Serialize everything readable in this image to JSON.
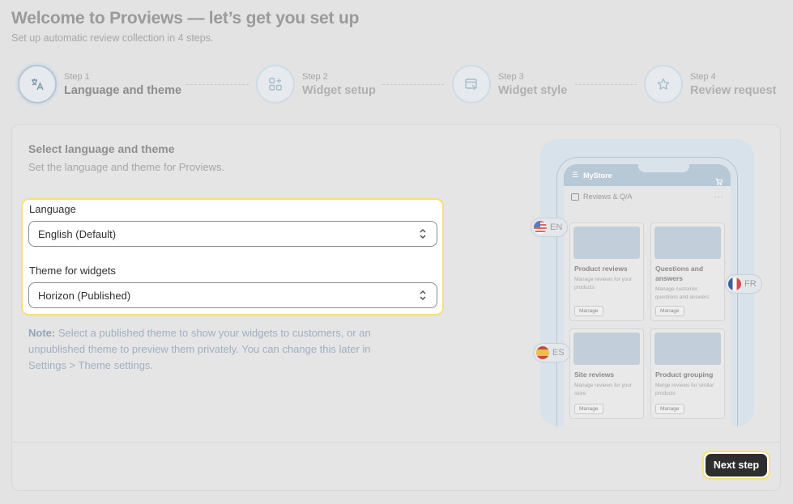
{
  "header": {
    "title": "Welcome to Proviews — let’s get you set up",
    "subtitle": "Set up automatic review collection in 4 steps."
  },
  "steps": [
    {
      "number": "Step 1",
      "label": "Language and theme",
      "icon": "translate-icon",
      "active": true
    },
    {
      "number": "Step 2",
      "label": "Widget setup",
      "icon": "widget-add-icon",
      "active": false
    },
    {
      "number": "Step 3",
      "label": "Widget style",
      "icon": "paint-window-icon",
      "active": false
    },
    {
      "number": "Step 4",
      "label": "Review request",
      "icon": "star-icon",
      "active": false
    }
  ],
  "section": {
    "title": "Select language and theme",
    "description": "Set the language and theme for Proviews."
  },
  "form": {
    "language_label": "Language",
    "language_value": "English (Default)",
    "theme_label": "Theme for widgets",
    "theme_value": "Horizon (Published)"
  },
  "note": {
    "prefix": "Note:",
    "line1": " Select a published theme to show your widgets to customers, or an",
    "line2": "unpublished theme to preview them privately. You can change this later in",
    "line3": "Settings > Theme settings."
  },
  "illustration": {
    "store_name": "MyStore",
    "app_title": "Reviews & Q/A",
    "tiles": [
      {
        "name": "Product reviews",
        "desc": "Manage reviews for your products",
        "button": "Manage"
      },
      {
        "name": "Questions and answers",
        "desc": "Manage customer questions and answers",
        "button": "Manage"
      },
      {
        "name": "Site reviews",
        "desc": "Manage reviews for your store",
        "button": "Manage"
      },
      {
        "name": "Product grouping",
        "desc": "Merge reviews for similar products",
        "button": "Manage"
      }
    ],
    "languages": {
      "en": "EN",
      "fr": "FR",
      "es": "ES"
    }
  },
  "footer": {
    "next_label": "Next step"
  },
  "colors": {
    "accent_highlight": "#f6e07a",
    "primary_button": "#2e2e2e",
    "note_text": "#9fb0c2"
  }
}
